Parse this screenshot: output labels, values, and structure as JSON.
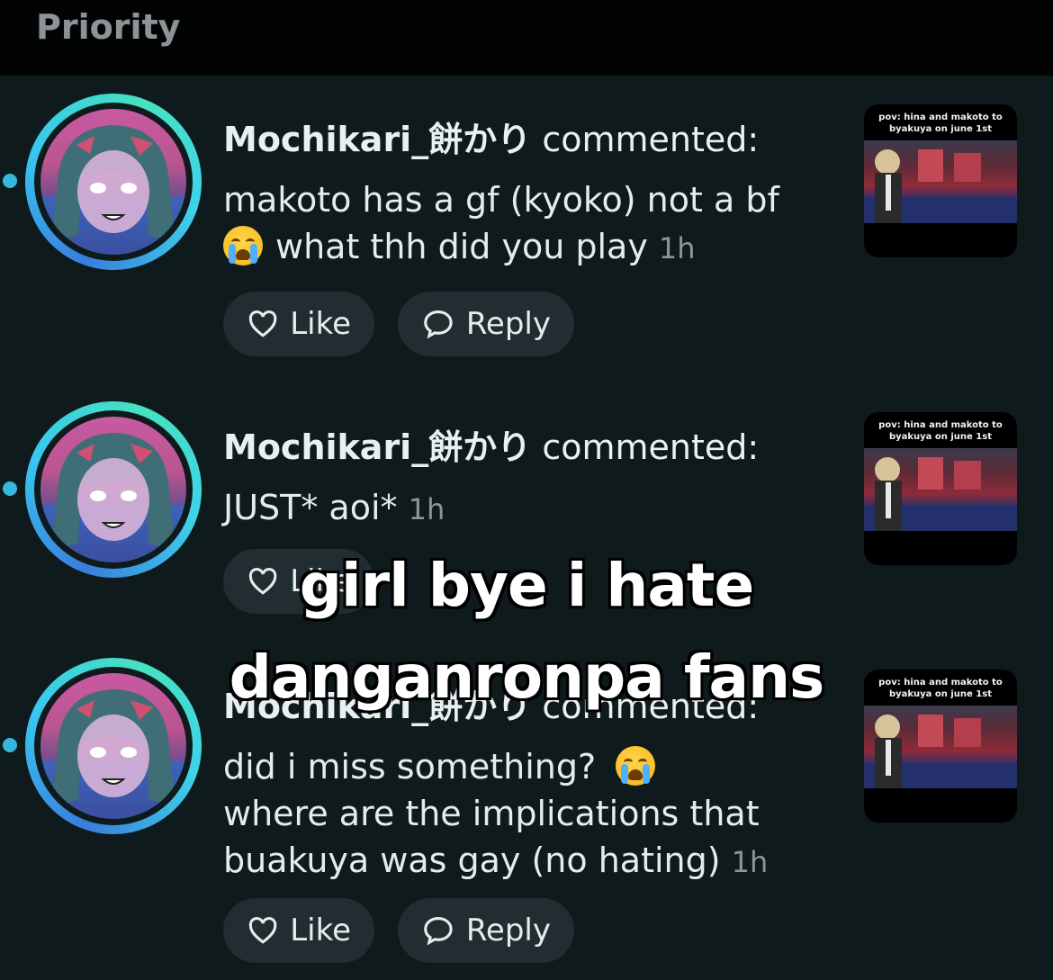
{
  "header": {
    "title": "Priority"
  },
  "notifications": [
    {
      "username": "Mochikari_餅かり",
      "action": "commented:",
      "comment_line1": "makoto has a gf (kyoko) not a bf",
      "comment_line2": "what thh did you play",
      "time": "1h",
      "like_label": "Like",
      "reply_label": "Reply",
      "thumb_caption": "pov: hina and makoto to byakuya on june 1st"
    },
    {
      "username": "Mochikari_餅かり",
      "action": "commented:",
      "comment_line1": "JUST* aoi*",
      "time": "1h",
      "like_label": "Like",
      "thumb_caption": "pov: hina and makoto to byakuya on june 1st"
    },
    {
      "username": "Mochikari_餅かり",
      "action": "commented:",
      "comment_line1": "did i miss something?",
      "comment_line2": "where are the implications that",
      "comment_line3": "buakuya was gay (no hating)",
      "time": "1h",
      "like_label": "Like",
      "reply_label": "Reply",
      "thumb_caption": "pov: hina and makoto to byakuya on june 1st"
    }
  ],
  "overlay": {
    "line1": "girl bye i hate",
    "line2": "danganronpa fans"
  },
  "icons": {
    "like": "heart-icon",
    "reply": "speech-bubble-icon",
    "emoji": "loudly-crying-face-icon"
  },
  "colors": {
    "background": "#0f1a1d",
    "unread_dot": "#35b8dc",
    "button": "#222d31"
  }
}
